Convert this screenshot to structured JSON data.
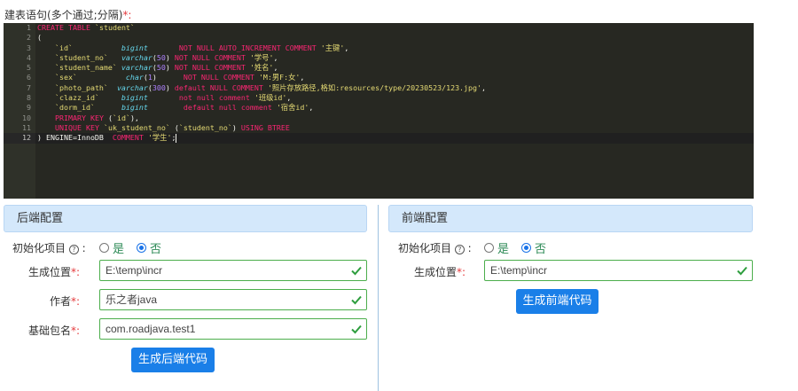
{
  "ddl_label": "建表语句(多个通过;分隔)",
  "ddl_required_mark": "*:",
  "editor": {
    "line_numbers": [
      "1",
      "2",
      "3",
      "4",
      "5",
      "6",
      "7",
      "8",
      "9",
      "10",
      "11",
      "12"
    ],
    "lines": [
      "CREATE TABLE `student`",
      "(",
      "    `id`           bigint       NOT NULL AUTO_INCREMENT COMMENT '主键',",
      "    `student_no`   varchar(50) NOT NULL COMMENT '学号',",
      "    `student_name` varchar(50) NOT NULL COMMENT '姓名',",
      "    `sex`           char(1)      NOT NULL COMMENT 'M:男F:女',",
      "    `photo_path`  varchar(300) default NULL COMMENT '照片存放路径,格如:resources/type/20230523/123.jpg',",
      "    `clazz_id`     bigint       not null comment '班级id',",
      "    `dorm_id`      bigint        default null comment '宿舍id',",
      "    PRIMARY KEY (`id`),",
      "    UNIQUE KEY `uk_student_no` (`student_no`) USING BTREE",
      ") ENGINE=InnoDB  COMMENT '学生';"
    ]
  },
  "backend": {
    "title": "后端配置",
    "init_label": "初始化项目",
    "init_suffix": ":",
    "init_options": [
      "是",
      "否"
    ],
    "init_selected": "否",
    "location_label": "生成位置",
    "location_value": "E:\\temp\\incr",
    "author_label": "作者",
    "author_value": "乐之者java",
    "package_label": "基础包名",
    "package_value": "com.roadjava.test1",
    "required_mark": "*:",
    "generate_button": "生成后端代码"
  },
  "frontend": {
    "title": "前端配置",
    "init_label": "初始化项目",
    "init_suffix": ":",
    "init_options": [
      "是",
      "否"
    ],
    "init_selected": "否",
    "location_label": "生成位置",
    "location_value": "E:\\temp\\incr",
    "required_mark": "*:",
    "generate_button": "生成前端代码"
  },
  "colors": {
    "editor_bg": "#272822",
    "panel_header_bg": "#d4e8fb",
    "button_bg": "#1a7fe8",
    "valid_border": "#4cae4c",
    "required": "#e4393c"
  },
  "icons": {
    "help": "question-circle-icon",
    "valid": "check-icon"
  }
}
